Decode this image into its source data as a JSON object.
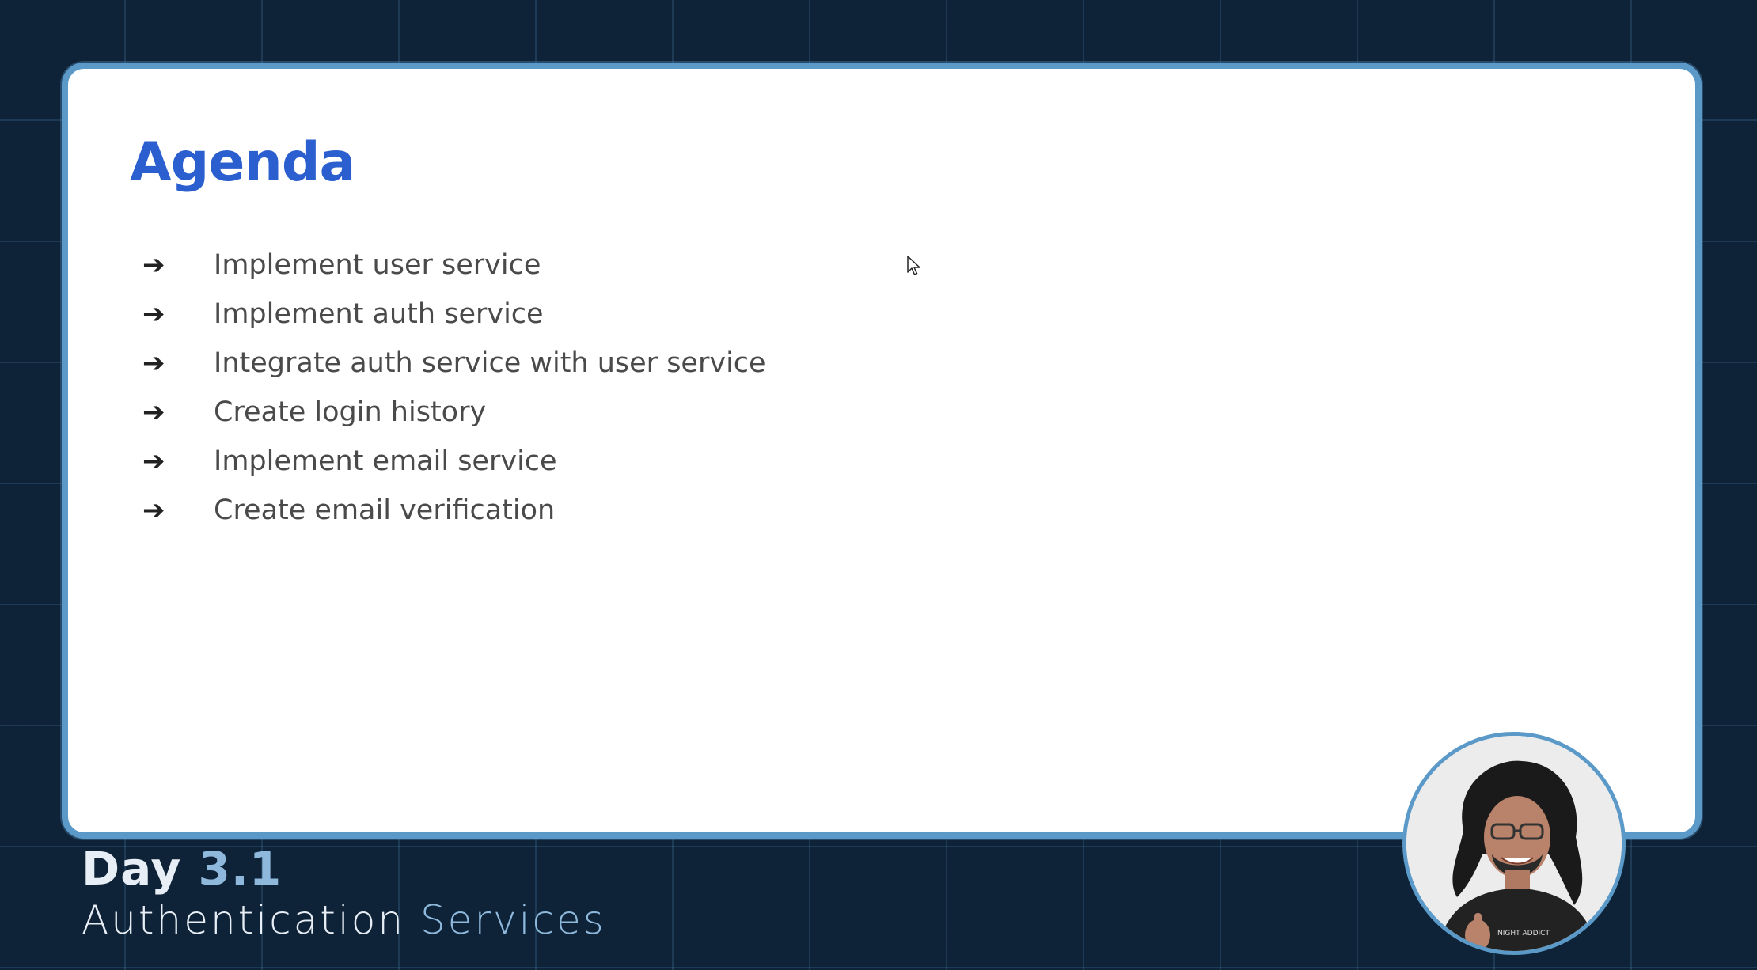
{
  "slide": {
    "title": "Agenda",
    "items": [
      "Implement user service",
      "Implement auth service",
      "Integrate auth service with user service",
      "Create login history",
      "Implement email service",
      "Create email verification"
    ],
    "bullet_icon": "arrow-right-icon"
  },
  "footer": {
    "day_label": "Day",
    "day_number": "3.1",
    "subtitle_part1": "Authentication ",
    "subtitle_part2": "Services"
  },
  "presenter": {
    "shirt_text": "NIGHT ADDICT"
  },
  "colors": {
    "background": "#0e2338",
    "frame_border": "#5b9ac8",
    "title": "#2b5fcf",
    "accent": "#8fb9dc"
  }
}
